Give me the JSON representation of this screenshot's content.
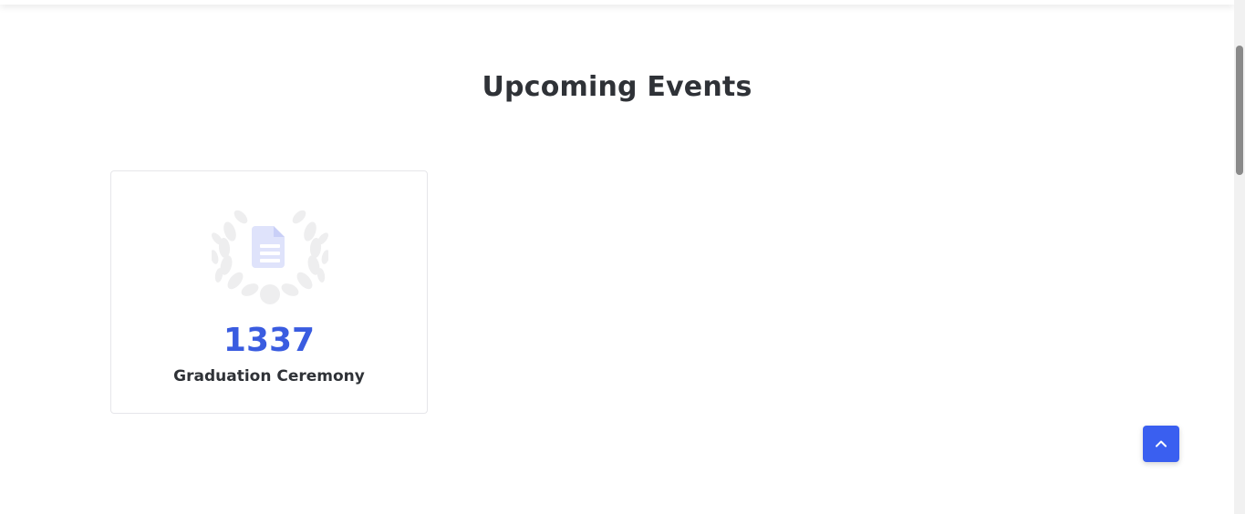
{
  "section": {
    "title": "Upcoming Events"
  },
  "events": [
    {
      "count": "1337",
      "name": "Graduation Ceremony",
      "icon": "document-icon",
      "decoration": "laurel-wreath"
    }
  ],
  "back_to_top": {
    "icon": "chevron-up-icon"
  },
  "colors": {
    "accent": "#3a5ce0",
    "button": "#3a5ff0",
    "heading": "#2f3237",
    "icon_tint": "#dfe3fb",
    "wreath": "#eeeeef"
  }
}
